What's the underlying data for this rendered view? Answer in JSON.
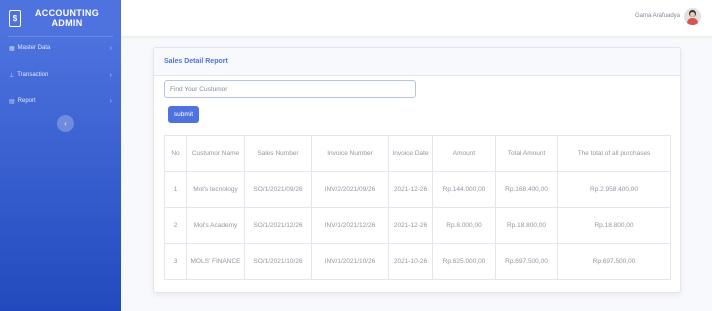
{
  "sidebar": {
    "brand_line1": "ACCOUNTING",
    "brand_line2": "ADMIN",
    "brand_icon": "$",
    "items": [
      {
        "label": "Master Data",
        "icon": "grid-icon"
      },
      {
        "label": "Transaction",
        "icon": "transaction-icon"
      },
      {
        "label": "Report",
        "icon": "table-icon"
      }
    ],
    "toggle_icon": "‹"
  },
  "topbar": {
    "user_name": "Gama Arafuadya"
  },
  "card": {
    "title": "Sales Detail Report",
    "search_placeholder": "Find Your Custumor",
    "submit_label": "submit"
  },
  "table": {
    "headers": [
      "No",
      "Custumor Name",
      "Sales Number",
      "Invoice Number",
      "Invoice Date",
      "Amount",
      "Total Amount",
      "The total of all purchases"
    ],
    "rows": [
      [
        "1",
        "Mol's tecnology",
        "SO/1/2021/09/26",
        "INV/2/2021/09/26",
        "2021-12-26",
        "Rp.144.000,00",
        "Rp.168.400,00",
        "Rp.2.958.400,00"
      ],
      [
        "2",
        "Mol's Academy",
        "SO/1/2021/12/26",
        "INV/1/2021/12/26",
        "2021-12-26",
        "Rp.8.000,00",
        "Rp.18.800,00",
        "Rp.18.800,00"
      ],
      [
        "3",
        "MOLS' FINANCE",
        "SO/1/2021/10/26",
        "INV/1/2021/10/26",
        "2021-10-26",
        "Rp.625.000,00",
        "Rp.697.500,00",
        "Rp.697.500,00"
      ]
    ]
  },
  "colors": {
    "primary": "#4e73df",
    "sidebar_gradient_end": "#224abe",
    "background": "#f8f9fc"
  }
}
